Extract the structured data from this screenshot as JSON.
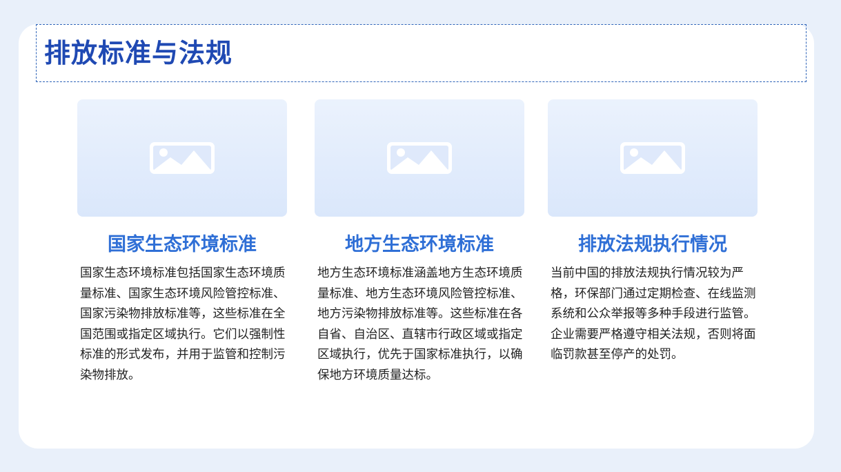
{
  "page": {
    "title": "排放标准与法规"
  },
  "columns": [
    {
      "title": "国家生态环境标准",
      "image_icon": "image-placeholder-icon",
      "text": "国家生态环境标准包括国家生态环境质量标准、国家生态环境风险管控标准、国家污染物排放标准等，这些标准在全国范围或指定区域执行。它们以强制性标准的形式发布，并用于监管和控制污染物排放。"
    },
    {
      "title": "地方生态环境标准",
      "image_icon": "image-placeholder-icon",
      "text": "地方生态环境标准涵盖地方生态环境质量标准、地方生态环境风险管控标准、地方污染物排放标准等。这些标准在各自省、自治区、直辖市行政区域或指定区域执行，优先于国家标准执行，以确保地方环境质量达标。"
    },
    {
      "title": "排放法规执行情况",
      "image_icon": "image-placeholder-icon",
      "text": "当前中国的排放法规执行情况较为严格，环保部门通过定期检查、在线监测系统和公众举报等多种手段进行监管。企业需要严格遵守相关法规，否则将面临罚款甚至停产的处罚。"
    }
  ],
  "colors": {
    "background": "#e9f0fa",
    "card": "#ffffff",
    "title": "#1f49b3",
    "heading": "#2f6fd6",
    "body_text": "#222222"
  }
}
